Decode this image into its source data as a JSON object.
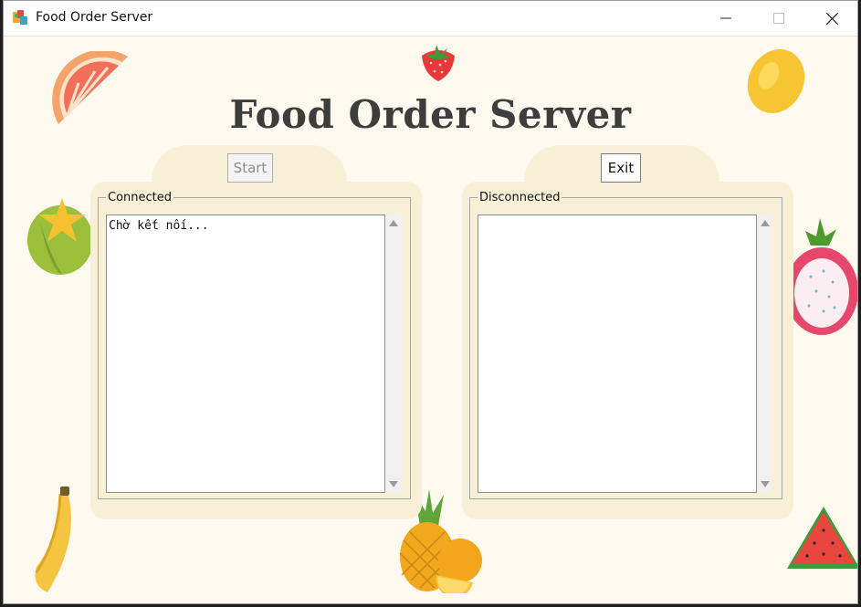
{
  "window": {
    "title": "Food Order Server"
  },
  "heading": "Food Order Server",
  "buttons": {
    "start": "Start",
    "exit": "Exit"
  },
  "panels": {
    "connected": {
      "label": "Connected",
      "content": "Chờ kết nối..."
    },
    "disconnected": {
      "label": "Disconnected",
      "content": ""
    }
  },
  "colors": {
    "background": "#fef9ef",
    "panel": "#f7efd6",
    "heading": "#3d3d3d"
  },
  "decorations": [
    "grapefruit-icon",
    "strawberry-icon",
    "lemon-icon",
    "starfruit-icon",
    "dragonfruit-icon",
    "banana-icon",
    "pineapple-icon",
    "orange-icon",
    "watermelon-icon"
  ]
}
